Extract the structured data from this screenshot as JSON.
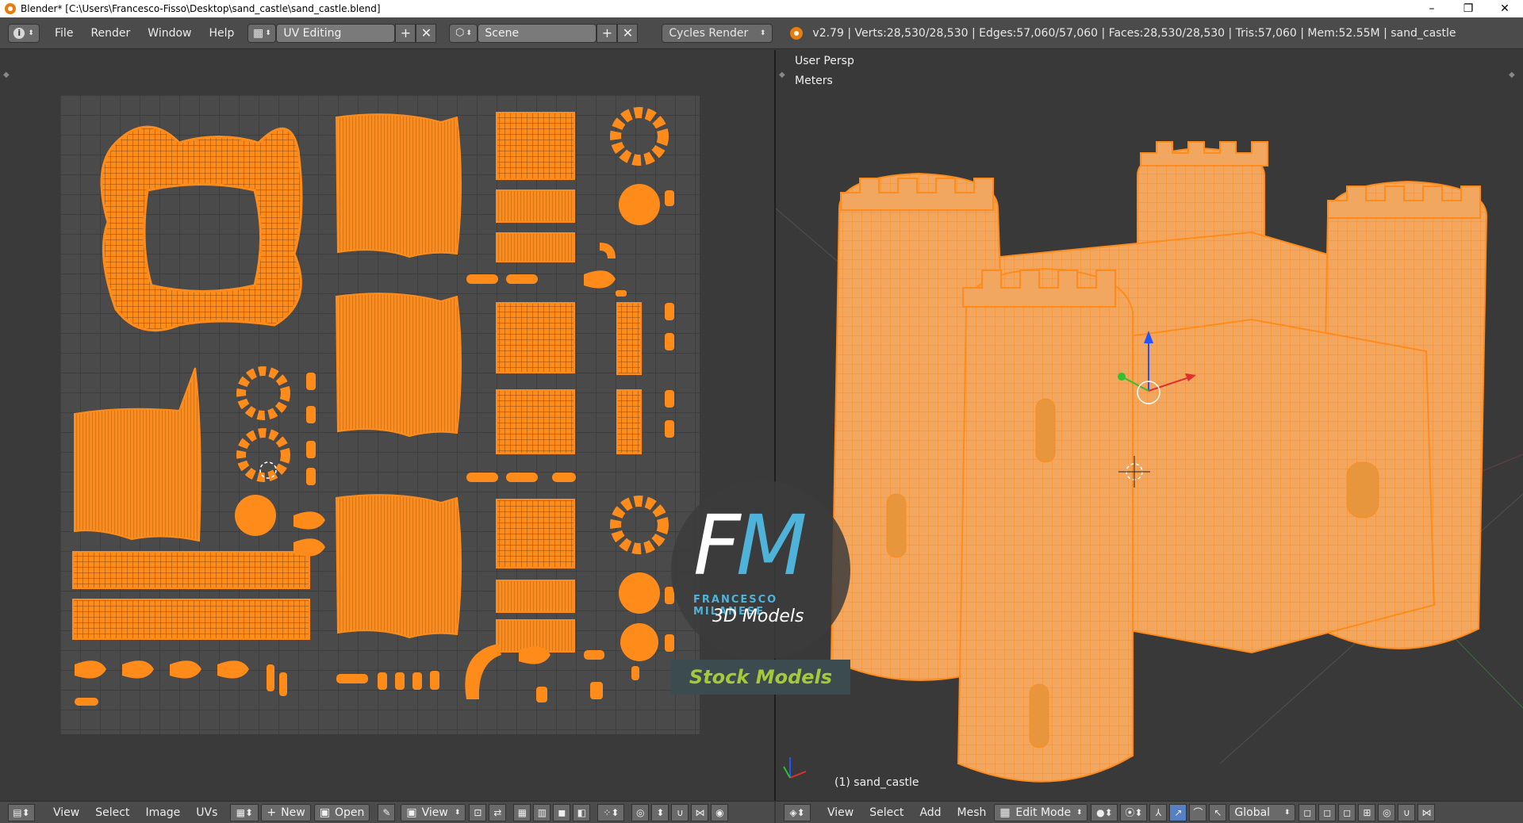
{
  "window": {
    "title": "Blender* [C:\\Users\\Francesco-Fisso\\Desktop\\sand_castle\\sand_castle.blend]",
    "minimize": "–",
    "maximize": "❐",
    "close": "✕"
  },
  "topbar": {
    "menus": [
      "File",
      "Render",
      "Window",
      "Help"
    ],
    "layout_value": "UV Editing",
    "scene_value": "Scene",
    "render_engine": "Cycles Render",
    "stats": "v2.79 | Verts:28,530/28,530 | Edges:57,060/57,060 | Faces:28,530/28,530 | Tris:57,060 | Mem:52.55M | sand_castle",
    "add_symbol": "+",
    "remove_symbol": "✕"
  },
  "uv_editor": {
    "menus": [
      "View",
      "Select",
      "Image",
      "UVs"
    ],
    "new_label": "New",
    "open_label": "Open",
    "view_label": "View"
  },
  "viewport": {
    "view_name": "User Persp",
    "units": "Meters",
    "object_label": "(1) sand_castle",
    "menus": [
      "View",
      "Select",
      "Add",
      "Mesh"
    ],
    "mode": "Edit Mode",
    "orientation": "Global"
  },
  "watermark": {
    "f": "F",
    "m": "M",
    "name": "FRANCESCO MILANESE",
    "sub": "3D Models",
    "stock": "Stock Models"
  },
  "colors": {
    "accent_orange": "#ff8c1a",
    "ui_bg": "#4b4b4b",
    "viewport_bg": "#393939",
    "watermark_blue": "#4fb3d9",
    "watermark_green": "#a6c93a"
  }
}
